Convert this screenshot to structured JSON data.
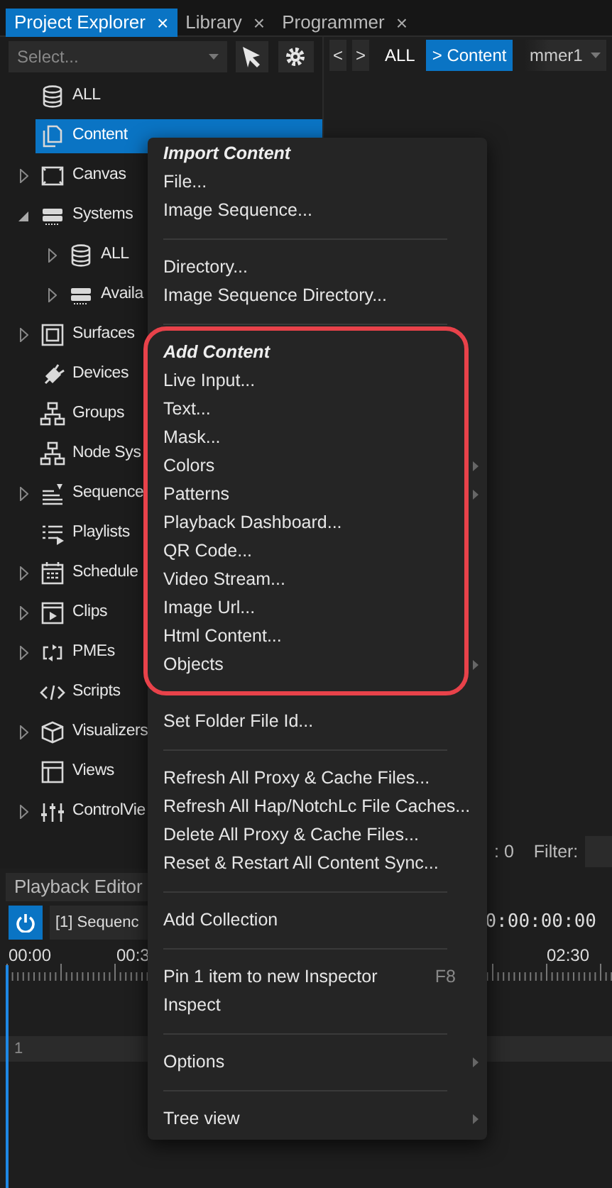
{
  "tabs": [
    {
      "label": "Project Explorer",
      "close": "×",
      "selected": true
    },
    {
      "label": "Library",
      "close": "×",
      "selected": false
    },
    {
      "label": "Programmer",
      "close": "×",
      "selected": false
    }
  ],
  "explorer": {
    "select": {
      "placeholder": "Select..."
    },
    "tree": [
      {
        "label": "ALL",
        "selected": false
      },
      {
        "label": "Content",
        "selected": true
      },
      {
        "label": "Canvas",
        "expanded": false,
        "selected": false
      },
      {
        "label": "Systems",
        "expanded": true,
        "selected": false,
        "children": [
          {
            "label": "ALL",
            "expanded": false,
            "selected": false
          },
          {
            "label": "Availa",
            "expanded": false,
            "selected": false
          }
        ]
      },
      {
        "label": "Surfaces",
        "expanded": false,
        "selected": false
      },
      {
        "label": "Devices",
        "selected": false
      },
      {
        "label": "Groups",
        "selected": false
      },
      {
        "label": "Node Sys",
        "selected": false
      },
      {
        "label": "Sequence",
        "expanded": false,
        "selected": false
      },
      {
        "label": "Playlists",
        "selected": false
      },
      {
        "label": "Schedule",
        "expanded": false,
        "selected": false
      },
      {
        "label": "Clips",
        "expanded": false,
        "selected": false
      },
      {
        "label": "PMEs",
        "expanded": false,
        "selected": false
      },
      {
        "label": "Scripts",
        "selected": false
      },
      {
        "label": "Visualizers",
        "expanded": false,
        "selected": false
      },
      {
        "label": "Views",
        "selected": false
      },
      {
        "label": "ControlVie",
        "expanded": false,
        "selected": false
      }
    ]
  },
  "breadcrumb": {
    "back": "<",
    "forward": ">",
    "items": [
      {
        "label": "ALL",
        "selected": false
      },
      {
        "label": "> Content",
        "selected": true
      }
    ],
    "dropdown": "mmer1"
  },
  "status": {
    "selected_count": ": 0",
    "filter_label": "Filter:"
  },
  "playback_editor": {
    "tab": "Playback Editor",
    "sequence": "[1] Sequenc",
    "timecode": "0:00:00:00",
    "ruler": [
      "00:00",
      "00:3",
      "02:30"
    ],
    "track": "1"
  },
  "context_menu": {
    "sections": [
      {
        "header": "Import Content",
        "items": [
          {
            "label": "File..."
          },
          {
            "label": "Image Sequence..."
          }
        ]
      },
      {
        "items": [
          {
            "label": "Directory..."
          },
          {
            "label": "Image Sequence Directory..."
          }
        ]
      },
      {
        "header": "Add Content",
        "highlighted": true,
        "items": [
          {
            "label": "Live Input..."
          },
          {
            "label": "Text..."
          },
          {
            "label": "Mask..."
          },
          {
            "label": "Colors",
            "submenu": true
          },
          {
            "label": "Patterns",
            "submenu": true
          },
          {
            "label": "Playback Dashboard..."
          },
          {
            "label": "QR Code..."
          },
          {
            "label": "Video Stream..."
          },
          {
            "label": "Image Url..."
          },
          {
            "label": "Html Content..."
          },
          {
            "label": "Objects",
            "submenu": true
          }
        ]
      },
      {
        "items": [
          {
            "label": "Set Folder File Id..."
          }
        ]
      },
      {
        "items": [
          {
            "label": "Refresh All Proxy & Cache Files..."
          },
          {
            "label": "Refresh All Hap/NotchLc File Caches..."
          },
          {
            "label": "Delete All Proxy & Cache Files..."
          },
          {
            "label": "Reset & Restart All Content Sync..."
          }
        ]
      },
      {
        "items": [
          {
            "label": "Add Collection"
          }
        ]
      },
      {
        "items": [
          {
            "label": "Pin 1 item to new Inspector",
            "shortcut": "F8"
          },
          {
            "label": "Inspect"
          }
        ]
      },
      {
        "items": [
          {
            "label": "Options",
            "submenu": true
          }
        ]
      },
      {
        "items": [
          {
            "label": "Tree view",
            "submenu": true
          }
        ]
      }
    ]
  }
}
